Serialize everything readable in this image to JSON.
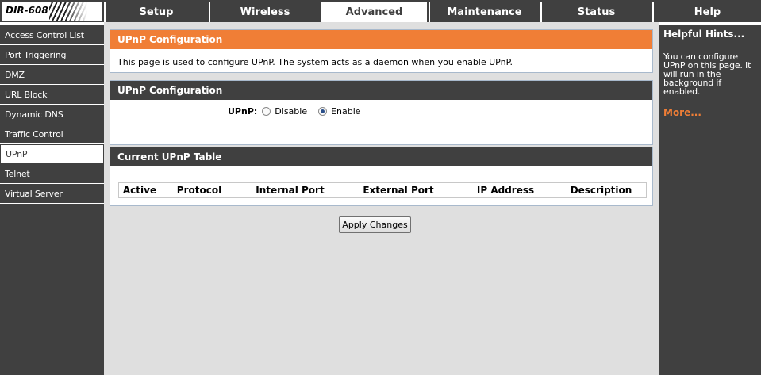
{
  "header": {
    "model": "DIR-608",
    "tabs": [
      {
        "label": "Setup"
      },
      {
        "label": "Wireless"
      },
      {
        "label": "Advanced"
      },
      {
        "label": "Maintenance"
      },
      {
        "label": "Status"
      },
      {
        "label": "Help"
      }
    ],
    "active_tab": "Advanced"
  },
  "sidebar": {
    "items": [
      {
        "label": "Access Control List"
      },
      {
        "label": "Port Triggering"
      },
      {
        "label": "DMZ"
      },
      {
        "label": "URL Block"
      },
      {
        "label": "Dynamic DNS"
      },
      {
        "label": "Traffic Control"
      },
      {
        "label": "UPnP"
      },
      {
        "label": "Telnet"
      },
      {
        "label": "Virtual Server"
      }
    ],
    "active_item": "UPnP"
  },
  "main": {
    "intro_title": "UPnP Configuration",
    "intro_text": "This page is used to configure UPnP. The system acts as a daemon when you enable UPnP.",
    "config_title": "UPnP Configuration",
    "upnp_label": "UPnP:",
    "options": [
      {
        "label": "Disable",
        "checked": false
      },
      {
        "label": "Enable",
        "checked": true
      }
    ],
    "table_title": "Current UPnP Table",
    "table_columns": [
      "Active",
      "Protocol",
      "Internal Port",
      "External Port",
      "IP Address",
      "Description"
    ],
    "table_rows": [],
    "apply_label": "Apply Changes"
  },
  "hints": {
    "title": "Helpful Hints...",
    "text": "You can configure UPnP on this page. It will run in the background if enabled.",
    "more": "More..."
  },
  "colors": {
    "dark": "#404040",
    "accent": "#f07e36",
    "content_bg": "#dfdfdf",
    "box_border": "#a8b9cc"
  }
}
